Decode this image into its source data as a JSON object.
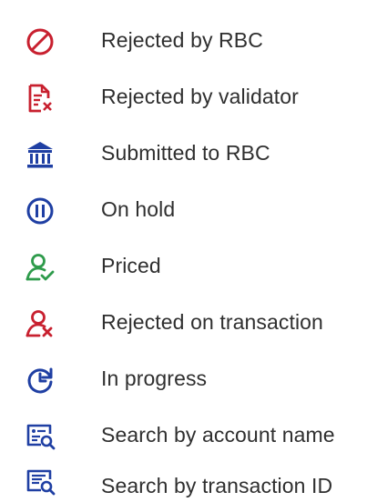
{
  "colors": {
    "red": "#c8202f",
    "blue": "#1f3fa3",
    "green": "#2e9b4b",
    "text": "#2f2f2f"
  },
  "legend": {
    "items": [
      {
        "icon": "prohibited-icon",
        "label": "Rejected by RBC"
      },
      {
        "icon": "document-rejected-icon",
        "label": "Rejected by validator"
      },
      {
        "icon": "bank-icon",
        "label": "Submitted to RBC"
      },
      {
        "icon": "pause-icon",
        "label": "On hold"
      },
      {
        "icon": "user-check-icon",
        "label": "Priced"
      },
      {
        "icon": "user-x-icon",
        "label": "Rejected on transaction"
      },
      {
        "icon": "refresh-clock-icon",
        "label": "In progress"
      },
      {
        "icon": "search-document-icon",
        "label": "Search by account name"
      },
      {
        "icon": "search-document-list-icon",
        "label": "Search by transaction ID"
      }
    ]
  }
}
